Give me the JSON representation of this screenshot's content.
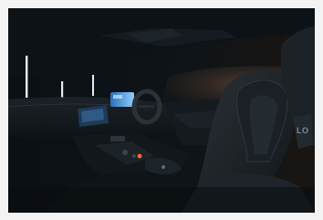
{
  "image": {
    "subject": "car-interior",
    "headrest_badge": "LO"
  },
  "colors": {
    "background": "#0b0f13",
    "interior": "#15191d",
    "seat": "#22282d",
    "light_strip": "#f2f6f7",
    "screen_blue": "#4aa3ff",
    "accent_orange": "#ff6a2a"
  }
}
